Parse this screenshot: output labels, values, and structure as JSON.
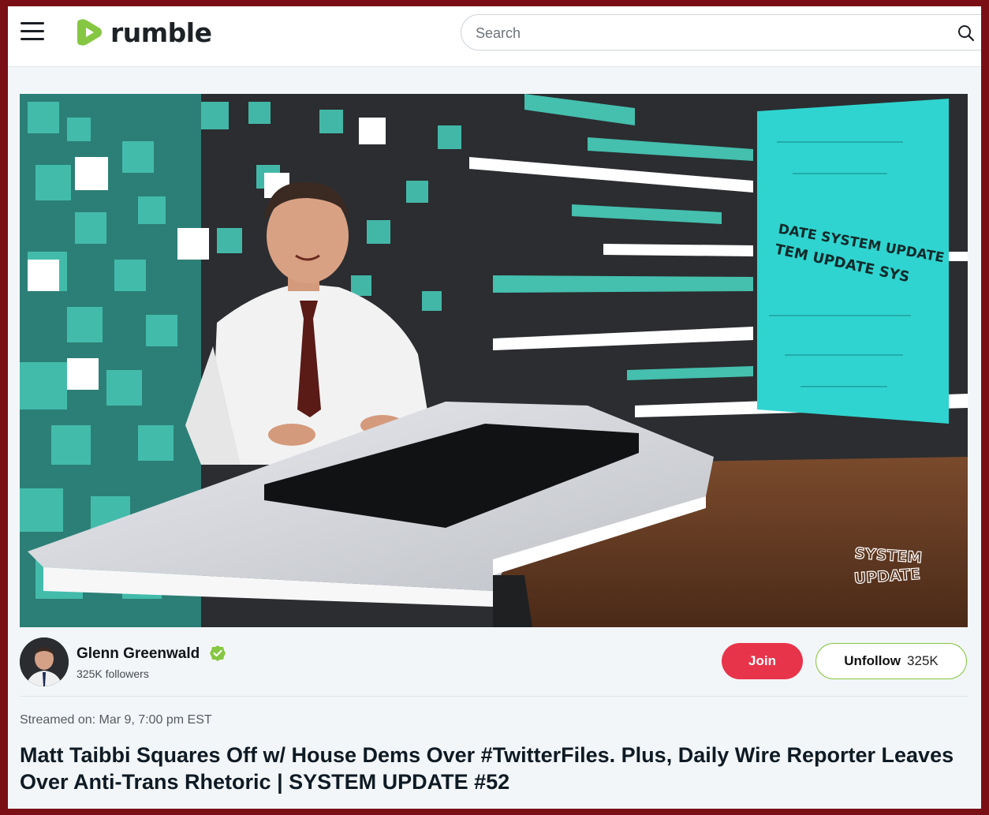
{
  "header": {
    "logo_text": "rumble",
    "search_placeholder": "Search"
  },
  "video": {
    "screen_text_line1": "DATE SYSTEM UPDATE",
    "screen_text_line2": "TEM UPDATE SYS",
    "watermark_line1": "SYSTEM",
    "watermark_line2": "UPDATE",
    "colors": {
      "accent_teal": "#3fb8a8",
      "screen_cyan": "#2fd4d0"
    }
  },
  "channel": {
    "name": "Glenn Greenwald",
    "followers": "325K followers",
    "join_label": "Join",
    "unfollow_label": "Unfollow",
    "unfollow_count": "325K"
  },
  "meta": {
    "streamed": "Streamed on: Mar 9, 7:00 pm EST"
  },
  "title": "Matt Taibbi Squares Off w/ House Dems Over #TwitterFiles. Plus, Daily Wire Reporter Leaves Over Anti-Trans Rhetoric | SYSTEM UPDATE #52",
  "colors": {
    "brand_green": "#85c742",
    "join_red": "#e8344a",
    "frame": "#7a0f16"
  }
}
